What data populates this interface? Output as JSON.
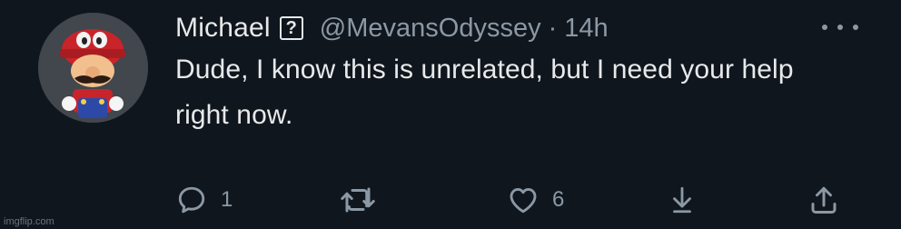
{
  "tweet": {
    "author_name": "Michael",
    "badge": "?",
    "handle": "@MevansOdyssey",
    "separator": "·",
    "time": "14h",
    "text": "Dude, I know this is unrelated, but I need your help right now.",
    "actions": {
      "reply_count": "1",
      "retweet_count": "",
      "like_count": "6"
    }
  },
  "icons": {
    "avatar": "mario-avatar",
    "more": "more-dots-icon",
    "reply": "reply-icon",
    "retweet": "retweet-icon",
    "like": "heart-icon",
    "bookmark": "bookmark-down-arrow-icon",
    "share": "share-icon"
  },
  "watermark": "imgflip.com",
  "colors": {
    "background": "#10161d",
    "primary_text": "#e7e9ea",
    "secondary_text": "#8b98a5"
  }
}
